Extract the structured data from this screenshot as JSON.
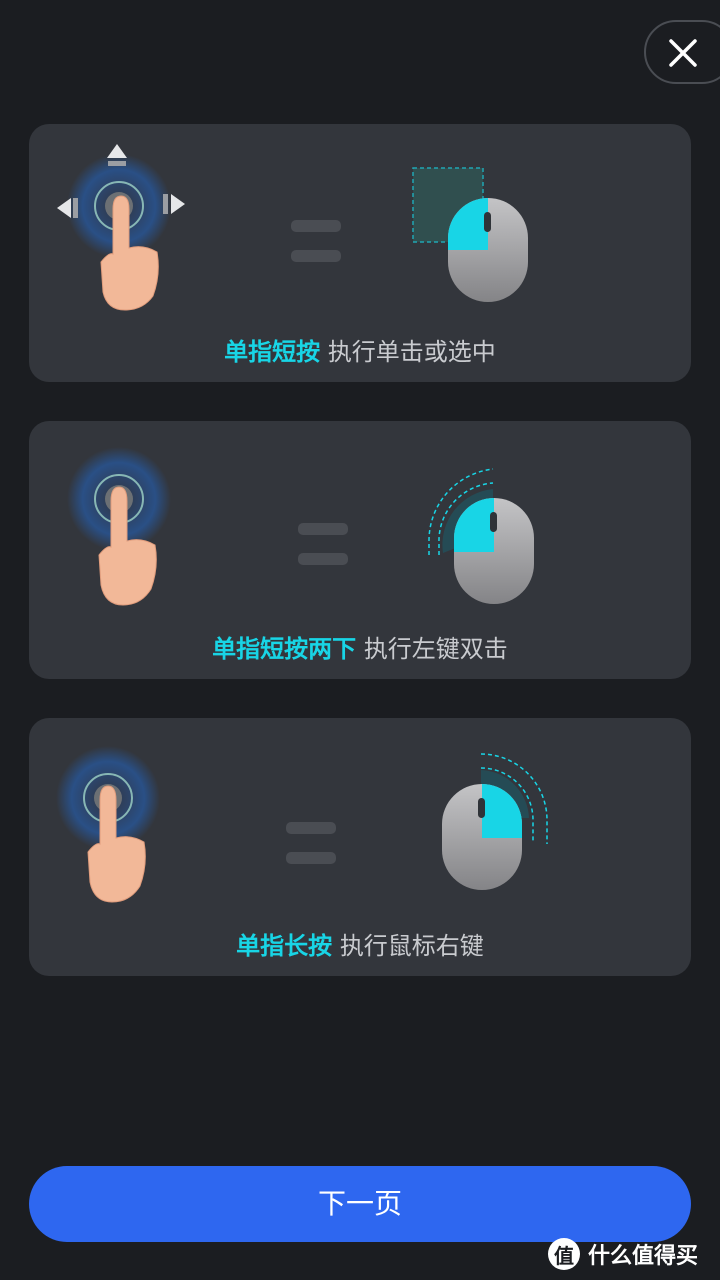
{
  "close": {
    "icon": "close-icon"
  },
  "cards": [
    {
      "gesture": "单指短按",
      "action": "执行单击或选中",
      "icon": "tap-with-arrows-icon",
      "mouse": "left-click-select-icon"
    },
    {
      "gesture": "单指短按两下",
      "action": "执行左键双击",
      "icon": "double-tap-icon",
      "mouse": "left-double-click-icon"
    },
    {
      "gesture": "单指长按",
      "action": "执行鼠标右键",
      "icon": "long-press-icon",
      "mouse": "right-click-icon"
    }
  ],
  "next_label": "下一页",
  "watermark": {
    "logo_char": "值",
    "text": "什么值得买"
  },
  "colors": {
    "accent": "#18d5e6",
    "primary_button": "#2e67f0",
    "card": "#33363c",
    "background": "#1b1d21"
  }
}
